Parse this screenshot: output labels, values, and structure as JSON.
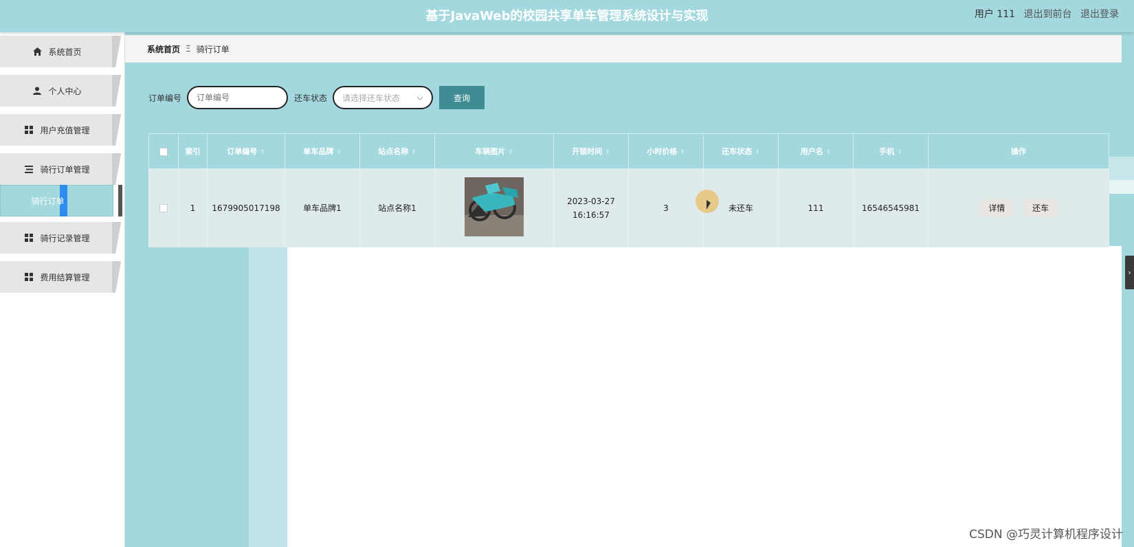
{
  "header": {
    "title": "基于JavaWeb的校园共享单车管理系统设计与实现",
    "user_label": "用户 111",
    "back_to_front": "退出到前台",
    "logout": "退出登录"
  },
  "sidebar": {
    "items": [
      {
        "label": "系统首页",
        "icon": "home-icon"
      },
      {
        "label": "个人中心",
        "icon": "user-icon"
      },
      {
        "label": "用户充值管理",
        "icon": "grid-icon"
      },
      {
        "label": "骑行订单管理",
        "icon": "list-icon"
      },
      {
        "label": "骑行订单",
        "icon": ""
      },
      {
        "label": "骑行记录管理",
        "icon": "grid-icon"
      },
      {
        "label": "费用结算管理",
        "icon": "grid-icon"
      }
    ]
  },
  "breadcrumb": {
    "home": "系统首页",
    "separator": "Ξ",
    "current": "骑行订单"
  },
  "search": {
    "order_no_label": "订单编号",
    "order_no_placeholder": "订单编号",
    "status_label": "还车状态",
    "status_placeholder": "请选择还车状态",
    "query_button": "查询"
  },
  "table": {
    "columns": [
      "索引",
      "订单编号",
      "单车品牌",
      "站点名称",
      "车辆图片",
      "开锁时间",
      "小时价格",
      "还车状态",
      "用户名",
      "手机",
      "操作"
    ],
    "rows": [
      {
        "index": "1",
        "order_no": "1679905017198",
        "brand": "单车品牌1",
        "station": "站点名称1",
        "image": "bike-photo",
        "unlock_time": "2023-03-27 16:16:57",
        "hour_price": "3",
        "return_status": "未还车",
        "username": "111",
        "phone": "16546545981",
        "actions": [
          "详情",
          "还车"
        ]
      }
    ]
  },
  "watermark": "CSDN @巧灵计算机程序设计",
  "colors": {
    "theme": "#a3d8df",
    "query_button": "#3f8c94",
    "row_bg": "#deeaeb"
  }
}
